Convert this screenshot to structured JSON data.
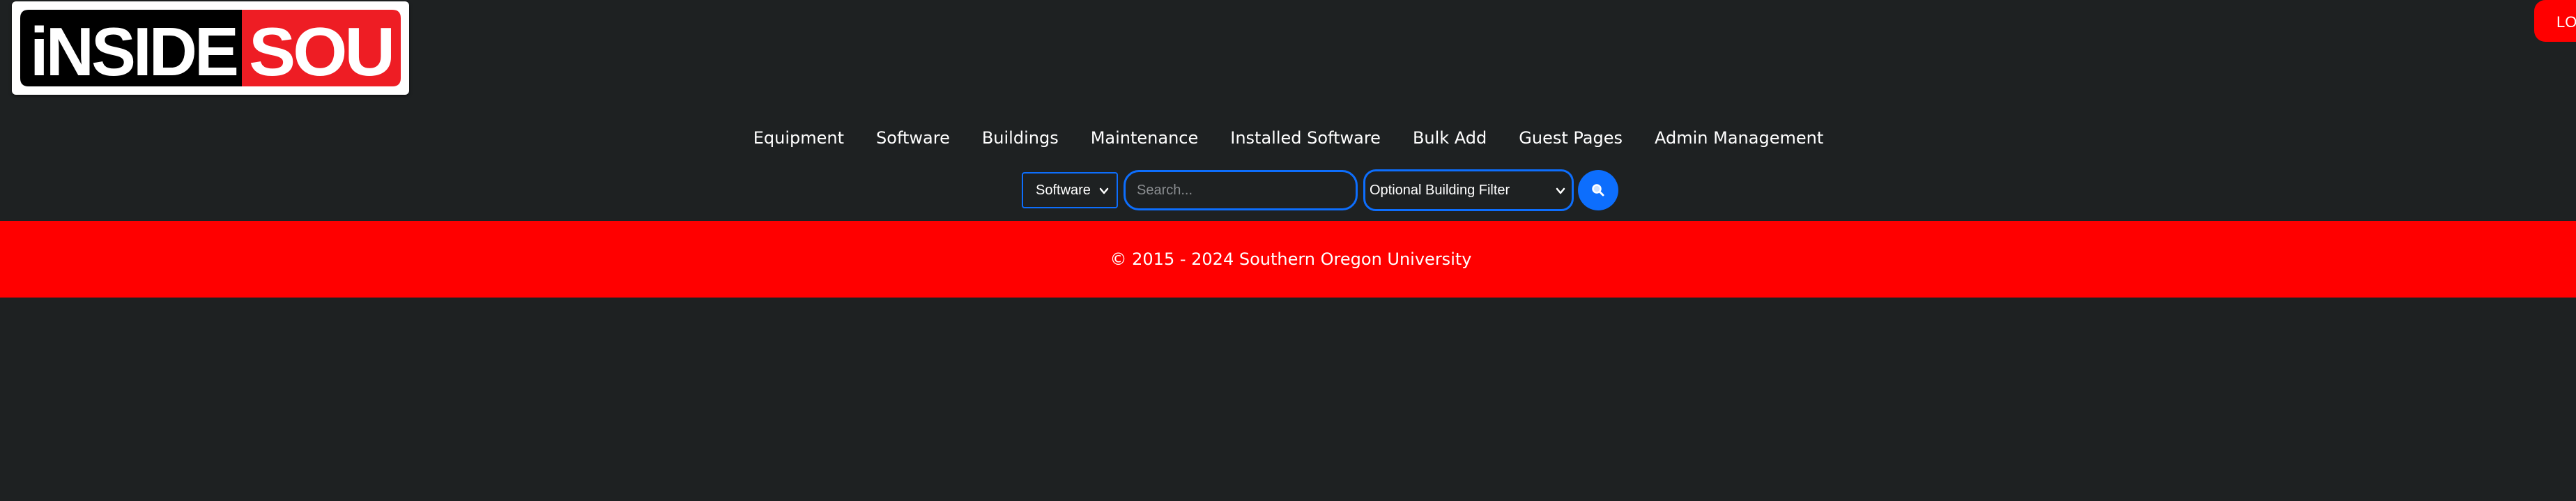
{
  "header": {
    "logo": {
      "text_left": "iNSIDE",
      "text_right": "SOU"
    },
    "login_label": "LOGIN"
  },
  "nav": {
    "items": [
      {
        "label": "Equipment"
      },
      {
        "label": "Software"
      },
      {
        "label": "Buildings"
      },
      {
        "label": "Maintenance"
      },
      {
        "label": "Installed Software"
      },
      {
        "label": "Bulk Add"
      },
      {
        "label": "Guest Pages"
      },
      {
        "label": "Admin Management"
      }
    ]
  },
  "search": {
    "type_selected": "Software",
    "placeholder": "Search...",
    "building_filter": "Optional Building Filter",
    "button_icon": "search-icon"
  },
  "footer": {
    "copyright": "© 2015 - 2024 Southern Oregon University"
  },
  "colors": {
    "background": "#1e2122",
    "accent_red": "#ff0000",
    "primary_blue": "#0d6efd",
    "text": "#ffffff"
  }
}
